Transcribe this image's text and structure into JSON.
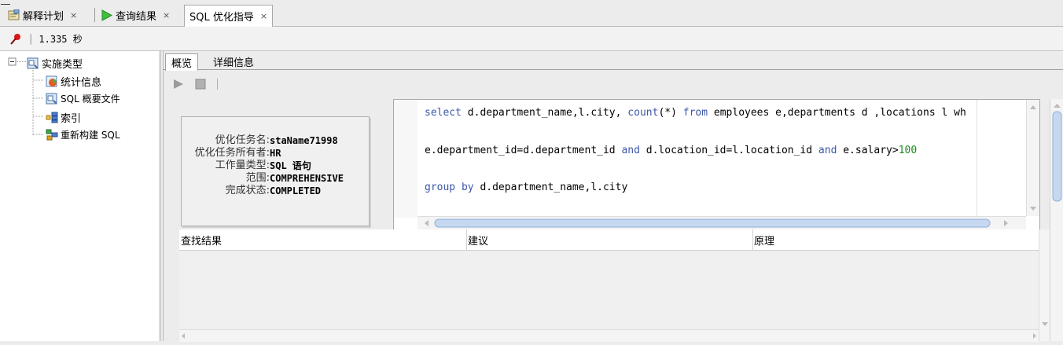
{
  "tabs": [
    {
      "label": "解释计划",
      "close": "×",
      "icon": "explain-plan-icon"
    },
    {
      "label": "查询结果",
      "close": "×",
      "icon": "run-triangle-icon"
    },
    {
      "label": "SQL 优化指导",
      "close": "×"
    }
  ],
  "status": {
    "icon": "pin-icon",
    "elapsed": "1.335 秒"
  },
  "tree": {
    "root": {
      "label": "实施类型",
      "icon": "report-icon"
    },
    "children": [
      {
        "label": "统计信息",
        "icon": "statistics-icon"
      },
      {
        "label": "SQL 概要文件",
        "icon": "sql-profile-icon"
      },
      {
        "label": "索引",
        "icon": "index-icon"
      },
      {
        "label": "重新构建 SQL",
        "icon": "restructure-sql-icon"
      }
    ]
  },
  "subtabs": [
    {
      "label": "概览"
    },
    {
      "label": "详细信息"
    }
  ],
  "summary": [
    {
      "label": "优化任务名:",
      "value": "staName71998"
    },
    {
      "label": "优化任务所有者:",
      "value": "HR"
    },
    {
      "label": "工作量类型:",
      "value": "SQL 语句"
    },
    {
      "label": "范围:",
      "value": "COMPREHENSIVE"
    },
    {
      "label": "完成状态:",
      "value": "COMPLETED"
    }
  ],
  "sql": {
    "line1": {
      "p1": "select",
      "p2": " d.department_name,l.city, ",
      "p3": "count",
      "p4": "(*) ",
      "p5": "from",
      "p6": " employees e,departments d ,locations l wh"
    },
    "line2": {
      "p1": "e.department_id=d.department_id ",
      "p2": "and",
      "p3": " d.location_id=l.location_id ",
      "p4": "and",
      "p5": " e.salary>",
      "p6": "100"
    },
    "line3": {
      "p1": "group by",
      "p2": " d.department_name,l.city"
    }
  },
  "grid": {
    "columns": [
      "查找结果",
      "建议",
      "原理"
    ]
  },
  "colors": {
    "keyword": "#3a57a8",
    "number": "#1b8c1b",
    "background": "#ececec"
  }
}
